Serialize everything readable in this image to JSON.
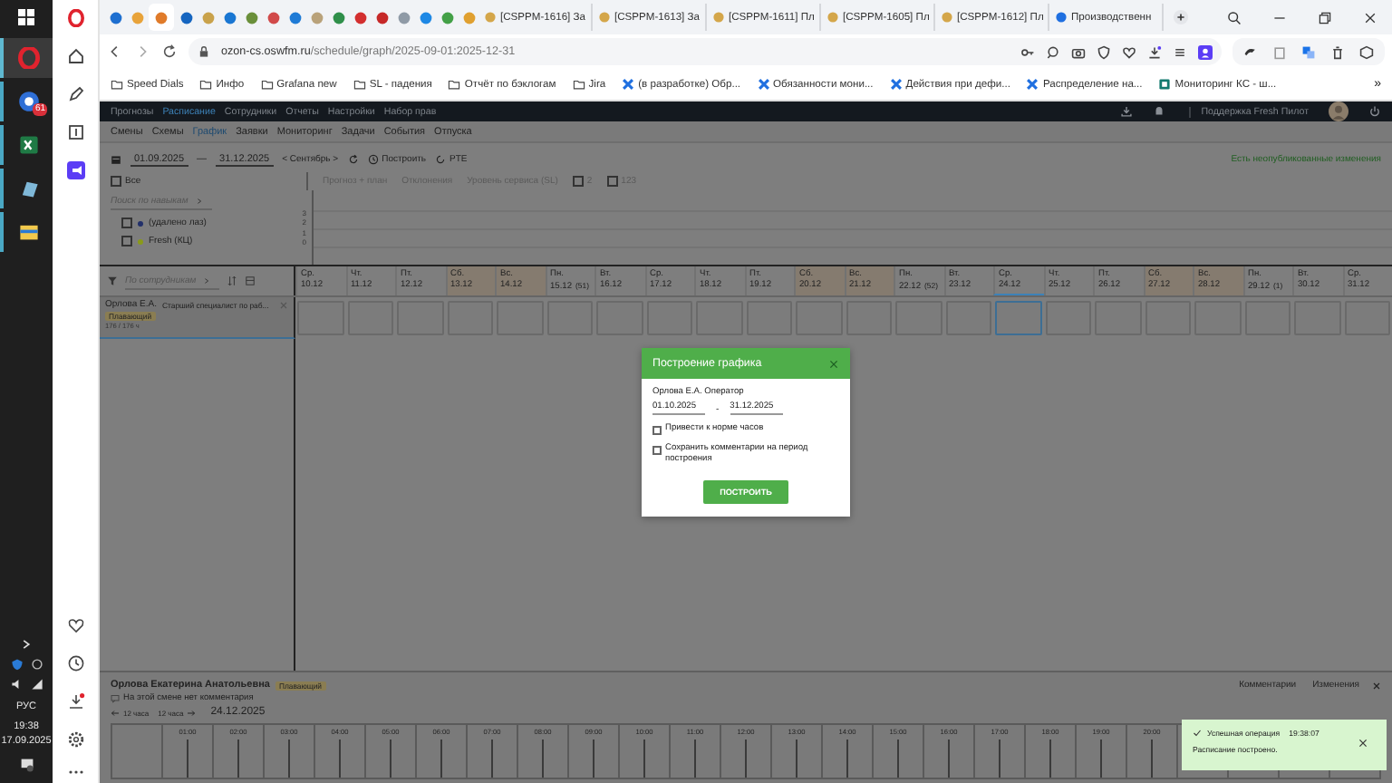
{
  "taskbar": {
    "badge": "61",
    "language": "РУС",
    "time": "19:38",
    "date": "17.09.2025"
  },
  "browser": {
    "pinned_tabs": [
      {
        "color": "#1e6fd0",
        "selected": false
      },
      {
        "color": "#e8a33a",
        "selected": false
      },
      {
        "color": "#e07b2a",
        "selected": true
      },
      {
        "color": "#1565c0",
        "selected": false
      },
      {
        "color": "#c9a24b",
        "selected": false
      },
      {
        "color": "#1976d2",
        "selected": false
      },
      {
        "color": "#6a8f3a",
        "selected": false
      },
      {
        "color": "#d14a4a",
        "selected": false
      },
      {
        "color": "#1f7bd6",
        "selected": false
      },
      {
        "color": "#b9a27a",
        "selected": false
      },
      {
        "color": "#2f8f4a",
        "selected": false
      },
      {
        "color": "#d32f2f",
        "selected": false
      },
      {
        "color": "#c62828",
        "selected": false
      },
      {
        "color": "#8f9aa6",
        "selected": false
      },
      {
        "color": "#1e88e5",
        "selected": false
      },
      {
        "color": "#43a047",
        "selected": false
      },
      {
        "color": "#e0a030",
        "selected": false
      }
    ],
    "tabs": [
      {
        "label": "[CSPPM-1616] За",
        "selected": false
      },
      {
        "label": "[CSPPM-1613] За",
        "selected": false
      },
      {
        "label": "[CSPPM-1611] Пл",
        "selected": false
      },
      {
        "label": "[CSPPM-1605] Пл",
        "selected": false
      },
      {
        "label": "[CSPPM-1612] Пл",
        "selected": false
      },
      {
        "label": "Производственн",
        "selected": false
      }
    ],
    "url_host": "ozon-cs.oswfm.ru",
    "url_path": "/schedule/graph/2025-09-01:2025-12-31",
    "bookmarks": [
      {
        "label": "Speed Dials",
        "kind": "folder"
      },
      {
        "label": "Инфо",
        "kind": "folder"
      },
      {
        "label": "Grafana new",
        "kind": "folder"
      },
      {
        "label": "SL - падения",
        "kind": "folder"
      },
      {
        "label": "Отчёт по бэклогам",
        "kind": "folder"
      },
      {
        "label": "Jira",
        "kind": "folder"
      },
      {
        "label": "(в разработке) Обр...",
        "kind": "page"
      },
      {
        "label": "Обязанности мони...",
        "kind": "page"
      },
      {
        "label": "Действия при дефи...",
        "kind": "page"
      },
      {
        "label": "Распределение на...",
        "kind": "page"
      },
      {
        "label": "Мониторинг КС - ш...",
        "kind": "sheet"
      }
    ],
    "more": "»"
  },
  "app": {
    "nav": [
      {
        "label": "Прогнозы",
        "selected": false
      },
      {
        "label": "Расписание",
        "selected": true
      },
      {
        "label": "Сотрудники",
        "selected": false
      },
      {
        "label": "Отчеты",
        "selected": false
      },
      {
        "label": "Настройки",
        "selected": false
      },
      {
        "label": "Набор прав",
        "selected": false
      }
    ],
    "support": "Поддержка Fresh Пилот",
    "subnav": [
      {
        "label": "Смены",
        "selected": false
      },
      {
        "label": "Схемы",
        "selected": false
      },
      {
        "label": "График",
        "selected": true
      },
      {
        "label": "Заявки",
        "selected": false
      },
      {
        "label": "Мониторинг",
        "selected": false
      },
      {
        "label": "Задачи",
        "selected": false
      },
      {
        "label": "События",
        "selected": false
      },
      {
        "label": "Отпуска",
        "selected": false
      }
    ],
    "toolbar": {
      "date_from": "01.09.2025",
      "dash": "—",
      "date_to": "31.12.2025",
      "month": "< Сентябрь >",
      "build": "Построить",
      "pte": "PTE",
      "unpublished": "Есть неопубликованные изменения"
    },
    "all_checkbox": {
      "label": "Все",
      "checked": false
    },
    "chart_tabs": [
      "Прогноз + план",
      "Отклонения",
      "Уровень сервиса (SL)"
    ],
    "chart_checks": [
      {
        "label": "2",
        "checked": false
      },
      {
        "label": "123",
        "checked": false
      }
    ],
    "skill_search": {
      "placeholder": "Поиск по навыкам"
    },
    "skills": [
      {
        "label": "(удалено лаз)",
        "color": "#22306a",
        "checked": false
      },
      {
        "label": "Fresh (КЦ)",
        "color": "#8a9a1a",
        "checked": false
      }
    ],
    "axis_labels": [
      "3",
      "2",
      "1",
      "0"
    ],
    "employee_search": {
      "placeholder": "По сотрудникам"
    },
    "days": [
      {
        "weekday": "Ср.",
        "date": "10.12",
        "weekend": false,
        "selected": false
      },
      {
        "weekday": "Чт.",
        "date": "11.12",
        "weekend": false,
        "selected": false
      },
      {
        "weekday": "Пт.",
        "date": "12.12",
        "weekend": false,
        "selected": false
      },
      {
        "weekday": "Сб.",
        "date": "13.12",
        "weekend": true,
        "selected": false
      },
      {
        "weekday": "Вс.",
        "date": "14.12",
        "weekend": true,
        "selected": false
      },
      {
        "weekday": "Пн.",
        "date": "15.12",
        "week": "(51)",
        "weekend": false,
        "selected": false
      },
      {
        "weekday": "Вт.",
        "date": "16.12",
        "weekend": false,
        "selected": false
      },
      {
        "weekday": "Ср.",
        "date": "17.12",
        "weekend": false,
        "selected": false
      },
      {
        "weekday": "Чт.",
        "date": "18.12",
        "weekend": false,
        "selected": false
      },
      {
        "weekday": "Пт.",
        "date": "19.12",
        "weekend": false,
        "selected": false
      },
      {
        "weekday": "Сб.",
        "date": "20.12",
        "weekend": true,
        "selected": false
      },
      {
        "weekday": "Вс.",
        "date": "21.12",
        "weekend": true,
        "selected": false
      },
      {
        "weekday": "Пн.",
        "date": "22.12",
        "week": "(52)",
        "weekend": false,
        "selected": false
      },
      {
        "weekday": "Вт.",
        "date": "23.12",
        "weekend": false,
        "selected": false
      },
      {
        "weekday": "Ср.",
        "date": "24.12",
        "weekend": false,
        "selected": true
      },
      {
        "weekday": "Чт.",
        "date": "25.12",
        "weekend": false,
        "selected": false
      },
      {
        "weekday": "Пт.",
        "date": "26.12",
        "weekend": false,
        "selected": false
      },
      {
        "weekday": "Сб.",
        "date": "27.12",
        "weekend": true,
        "selected": false
      },
      {
        "weekday": "Вс.",
        "date": "28.12",
        "weekend": true,
        "selected": false
      },
      {
        "weekday": "Пн.",
        "date": "29.12",
        "week": "(1)",
        "weekend": false,
        "selected": false
      },
      {
        "weekday": "Вт.",
        "date": "30.12",
        "weekend": false,
        "selected": false
      },
      {
        "weekday": "Ср.",
        "date": "31.12",
        "weekend": false,
        "selected": false
      }
    ],
    "employee": {
      "name": "Орлова Е.А.",
      "position": "Старший специалист по раб...",
      "badge": "Плавающий",
      "hours": "176 / 176 ч"
    },
    "details": {
      "name": "Орлова Екатерина Анатольевна",
      "badge": "Плавающий",
      "comment": "На этой смене нет комментария",
      "prev": "12 часа",
      "next": "12 часа",
      "date": "24.12.2025",
      "tabs": [
        "Комментарии",
        "Изменения"
      ],
      "hours": [
        "01:00",
        "02:00",
        "03:00",
        "04:00",
        "05:00",
        "06:00",
        "07:00",
        "08:00",
        "09:00",
        "10:00",
        "11:00",
        "12:00",
        "13:00",
        "14:00",
        "15:00",
        "16:00",
        "17:00",
        "18:00",
        "19:00",
        "20:00"
      ]
    },
    "modal": {
      "title": "Построение графика",
      "employee": "Орлова Е.А. Оператор",
      "date_from": "01.10.2025",
      "dash": "-",
      "date_to": "31.12.2025",
      "options": [
        {
          "label": "Привести к норме часов",
          "checked": false
        },
        {
          "label": "Сохранить комментарии на период построения",
          "checked": false
        }
      ],
      "button": "ПОСТРОИТЬ"
    },
    "toast": {
      "title": "Успешная операция",
      "time": "19:38:07",
      "message": "Расписание построено."
    }
  }
}
